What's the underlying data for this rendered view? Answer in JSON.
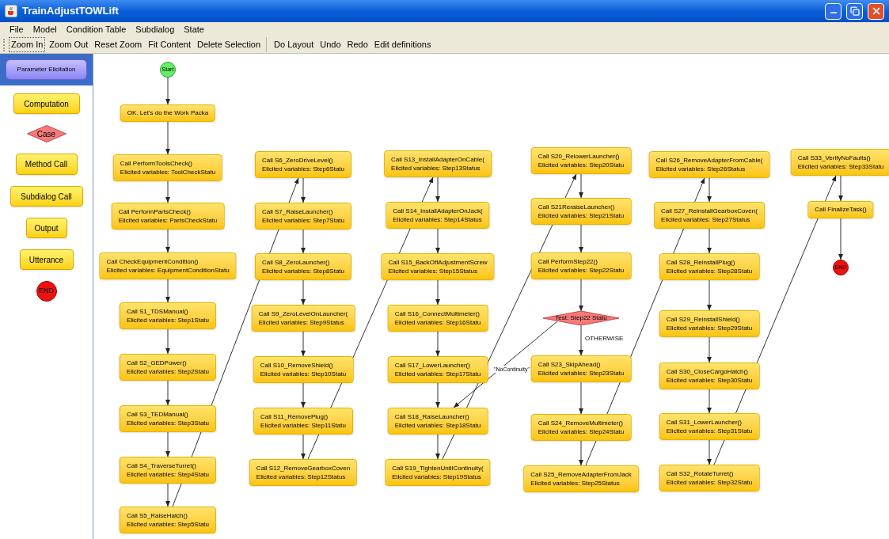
{
  "window": {
    "title": "TrainAdjustTOWLift"
  },
  "menu": [
    "File",
    "Model",
    "Condition Table",
    "Subdialog",
    "State"
  ],
  "toolbar": [
    [
      {
        "label": "Zoom In",
        "focused": true
      },
      {
        "label": "Zoom Out",
        "focused": false
      },
      {
        "label": "Reset Zoom",
        "focused": false
      },
      {
        "label": "Fit Content",
        "focused": false
      },
      {
        "label": "Delete Selection",
        "focused": false
      }
    ],
    [
      {
        "label": "Do Layout",
        "focused": false
      },
      {
        "label": "Undo",
        "focused": false
      },
      {
        "label": "Redo",
        "focused": false
      },
      {
        "label": "Edit definitions",
        "focused": false
      }
    ]
  ],
  "palette": {
    "header": {
      "label": "Parameter Elicitation",
      "selected": true
    },
    "items": [
      {
        "kind": "computation",
        "label": "Computation"
      },
      {
        "kind": "case",
        "label": "Case"
      },
      {
        "kind": "method",
        "label": "Method Call"
      },
      {
        "kind": "subdialog",
        "label": "Subdialog Call"
      },
      {
        "kind": "output",
        "label": "Output"
      },
      {
        "kind": "utterance",
        "label": "Utterance"
      },
      {
        "kind": "end",
        "label": "END"
      }
    ]
  },
  "diagram": {
    "columns": [
      [
        {
          "kind": "start",
          "label": "Start"
        },
        {
          "kind": "message",
          "label": "OK. Let's do the Work Packa"
        },
        {
          "kind": "call",
          "call": "Call PerformToolsCheck()",
          "vars": "Elicited variables: ToolCheckStatu"
        },
        {
          "kind": "call",
          "call": "Call PerformPartsCheck()",
          "vars": "Elicited variables: PartsCheckStatu"
        },
        {
          "kind": "call",
          "call": "Call CheckEquipmentCondition()",
          "vars": "Elicited variables: EquipmentConditionStatu"
        },
        {
          "kind": "call",
          "call": "Call S1_TDSManual()",
          "vars": "Elicited variables: Step1Statu"
        },
        {
          "kind": "call",
          "call": "Call S2_GEDPower()",
          "vars": "Elicited variables: Step2Statu"
        },
        {
          "kind": "call",
          "call": "Call S3_TEDManual()",
          "vars": "Elicited variables: Step3Statu"
        },
        {
          "kind": "call",
          "call": "Call S4_TraverseTurret()",
          "vars": "Elicited variables: Step4Statu"
        },
        {
          "kind": "call",
          "call": "Call S5_RaiseHatch()",
          "vars": "Elicited variables: Step5Statu"
        }
      ],
      [
        {
          "kind": "call",
          "call": "Call S6_ZeroDriveLevel()",
          "vars": "Elicited variables: Step6Statu"
        },
        {
          "kind": "call",
          "call": "Call S7_RaiseLauncher()",
          "vars": "Elicited variables: Step7Statu"
        },
        {
          "kind": "call",
          "call": "Call S8_ZeroLauncher()",
          "vars": "Elicited variables: Step8Statu"
        },
        {
          "kind": "call",
          "call": "Call S9_ZeroLevelOnLauncher(",
          "vars": "Elicited variables: Step9Status"
        },
        {
          "kind": "call",
          "call": "Call S10_RemoveShield()",
          "vars": "Elicited variables: Step10Statu"
        },
        {
          "kind": "call",
          "call": "Call S11_RemovePlug()",
          "vars": "Elicited variables: Step11Statu"
        },
        {
          "kind": "call",
          "call": "Call S12_RemoveGearboxCoven",
          "vars": "Elicited variables: Step12Status"
        }
      ],
      [
        {
          "kind": "call",
          "call": "Call S13_InstallAdapterOnCable(",
          "vars": "Elicited variables: Step13Status"
        },
        {
          "kind": "call",
          "call": "Call S14_InstallAdapterOnJack(",
          "vars": "Elicited variables: Step14Status"
        },
        {
          "kind": "call",
          "call": "Call S15_BackOffAdjustmentScrew",
          "vars": "Elicited variables: Step15Status"
        },
        {
          "kind": "call",
          "call": "Call S16_ConnectMultimeter()",
          "vars": "Elicited variables: Step16Statu"
        },
        {
          "kind": "call",
          "call": "Call S17_LowerLauncher()",
          "vars": "Elicited variables: Step17Statu"
        },
        {
          "kind": "call",
          "call": "Call S18_RaiseLauncher()",
          "vars": "Elicited variables: Step18Statu"
        },
        {
          "kind": "call",
          "call": "Call S19_TightenUntilContinuity(",
          "vars": "Elicited variables: Step19Status"
        }
      ],
      [
        {
          "kind": "call",
          "call": "Call S20_RelowerLauncher()",
          "vars": "Elicited variables: Step20Statu"
        },
        {
          "kind": "call",
          "call": "Call S21ReraiseLauncher()",
          "vars": "Elicited variables: Step21Statu"
        },
        {
          "kind": "call",
          "call": "Call PerformStep22()",
          "vars": "Elicited variables: Step22Statu"
        },
        {
          "kind": "test",
          "label": "Test: Step22 Statu",
          "otherwise": "OTHERWISE",
          "branch": "\"NoContinuity\""
        },
        {
          "kind": "call",
          "call": "Call S23_SkipAhead()",
          "vars": "Elicited variables: Step23Statu"
        },
        {
          "kind": "call",
          "call": "Call S24_RemoveMultimeter()",
          "vars": "Elicited variables: Step24Statu"
        },
        {
          "kind": "call",
          "call": "Call S25_RemoveAdapterFromJack",
          "vars": "Elicited variables: Step25Status"
        }
      ],
      [
        {
          "kind": "call",
          "call": "Call S26_RemoveAdapterFromCable(",
          "vars": "Elicited variables: Step26Status"
        },
        {
          "kind": "call",
          "call": "Call S27_ReinstallGearboxCoven(",
          "vars": "Elicited variables: Step27Status"
        },
        {
          "kind": "call",
          "call": "Call S28_ReinstallPlug()",
          "vars": "Elicited variables: Step28Statu"
        },
        {
          "kind": "call",
          "call": "Call S29_ReinstallShield()",
          "vars": "Elicited variables: Step29Statu"
        },
        {
          "kind": "call",
          "call": "Call S30_CloseCargoHatch()",
          "vars": "Elicited variables: Step30Statu"
        },
        {
          "kind": "call",
          "call": "Call S31_LowerLauncher()",
          "vars": "Elicited variables: Step31Statu"
        },
        {
          "kind": "call",
          "call": "Call S32_RotateTurret()",
          "vars": "Elicited variables: Step32Statu"
        }
      ],
      [
        {
          "kind": "call",
          "call": "Call S33_VerifyNoFaults()",
          "vars": "Elicited variables: Step33Statu"
        },
        {
          "kind": "message",
          "label": "Call FinalizeTask()"
        },
        {
          "kind": "end",
          "label": "END"
        }
      ]
    ]
  }
}
